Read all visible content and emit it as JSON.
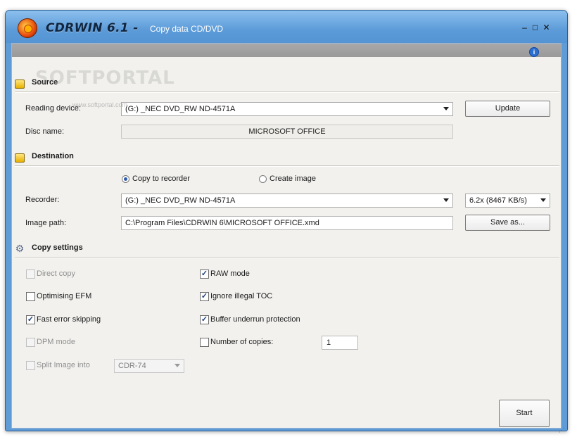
{
  "window": {
    "app_name": "CDRWIN 6.1 -",
    "subtitle": "Copy data CD/DVD",
    "controls": [
      "–",
      "□",
      "✕"
    ]
  },
  "watermark": {
    "text": "SOFTPORTAL",
    "url": "www.softportal.com"
  },
  "source": {
    "title": "Source",
    "reading_device_label": "Reading device:",
    "reading_device_value": "(G:) _NEC DVD_RW ND-4571A",
    "update_label": "Update",
    "disc_name_label": "Disc name:",
    "disc_name_value": "MICROSOFT OFFICE"
  },
  "destination": {
    "title": "Destination",
    "copy_to_recorder_label": "Copy to recorder",
    "copy_to_recorder_selected": true,
    "create_image_label": "Create image",
    "create_image_selected": false,
    "recorder_label": "Recorder:",
    "recorder_value": "(G:) _NEC DVD_RW ND-4571A",
    "speed_value": "6.2x (8467 KB/s)",
    "image_path_label": "Image path:",
    "image_path_value": "C:\\Program Files\\CDRWIN 6\\MICROSOFT OFFICE.xmd",
    "save_as_label": "Save as..."
  },
  "copy_settings": {
    "title": "Copy settings",
    "direct_copy": {
      "label": "Direct copy",
      "checked": false,
      "enabled": false
    },
    "optimising_efm": {
      "label": "Optimising EFM",
      "checked": false,
      "enabled": true
    },
    "fast_error_skipping": {
      "label": "Fast error skipping",
      "checked": true,
      "enabled": true
    },
    "dpm_mode": {
      "label": "DPM mode",
      "checked": false,
      "enabled": false
    },
    "split_image": {
      "label": "Split Image into",
      "checked": false,
      "enabled": false,
      "value": "CDR-74"
    },
    "raw_mode": {
      "label": "RAW mode",
      "checked": true,
      "enabled": true
    },
    "ignore_illegal_toc": {
      "label": "Ignore illegal TOC",
      "checked": true,
      "enabled": true
    },
    "buffer_underrun": {
      "label": "Buffer underrun protection",
      "checked": true,
      "enabled": true
    },
    "number_of_copies": {
      "label": "Number of copies:",
      "checked": false,
      "enabled": true,
      "value": "1"
    }
  },
  "start_label": "Start",
  "colors": {
    "titlebar": "#5f9bd6",
    "client_bg": "#f2f1ee",
    "strip": "#9e9e9e"
  }
}
